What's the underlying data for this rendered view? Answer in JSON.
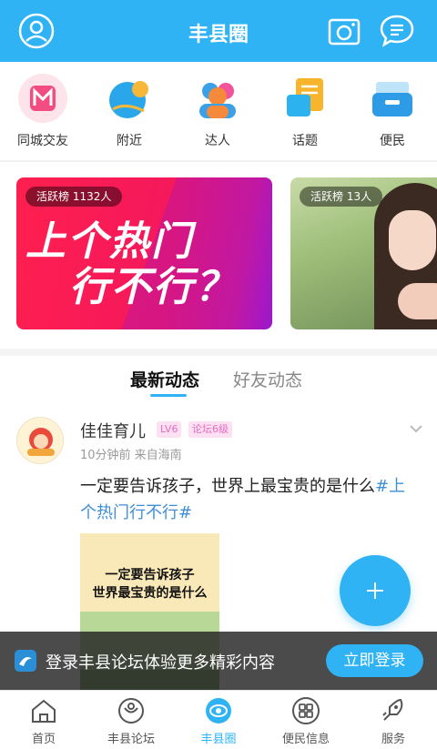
{
  "header": {
    "title": "丰县圈"
  },
  "categories": [
    {
      "label": "同城交友",
      "icon": "heart-m-icon"
    },
    {
      "label": "附近",
      "icon": "location-icon"
    },
    {
      "label": "达人",
      "icon": "people-icon"
    },
    {
      "label": "话题",
      "icon": "topic-icon"
    },
    {
      "label": "便民",
      "icon": "service-box-icon"
    }
  ],
  "banners": [
    {
      "badge": "活跃榜 1132人",
      "line1": "上个热门",
      "line2": "行不行？"
    },
    {
      "badge": "活跃榜 13人"
    }
  ],
  "feed_tabs": {
    "active": "最新动态",
    "inactive": "好友动态"
  },
  "post": {
    "author": "佳佳育儿",
    "level": "LV6",
    "forum_level": "论坛6级",
    "meta": "10分钟前  来自海南",
    "text": "一定要告诉孩子，世界上最宝贵的是什么",
    "topic": "#上个热门行不行#",
    "image_caption_1": "一定要告诉孩子",
    "image_caption_2": "世界最宝贵的是什么"
  },
  "login_prompt": {
    "text": "登录丰县论坛体验更多精彩内容",
    "button": "立即登录"
  },
  "bottom_nav": [
    {
      "label": "首页",
      "icon": "home-icon"
    },
    {
      "label": "丰县论坛",
      "icon": "forum-icon"
    },
    {
      "label": "丰县圈",
      "icon": "circle-eye-icon"
    },
    {
      "label": "便民信息",
      "icon": "grid-icon"
    },
    {
      "label": "服务",
      "icon": "rocket-icon"
    }
  ],
  "colors": {
    "primary": "#2fb3f4",
    "banner_red": "#ff1f4e",
    "topic_blue": "#3f8fd8",
    "badge_pink": "#e66bc0"
  }
}
